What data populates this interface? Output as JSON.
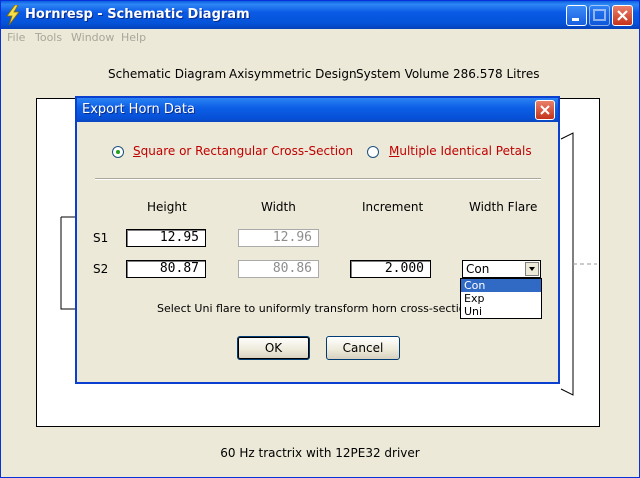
{
  "window": {
    "title": "Hornresp - Schematic Diagram"
  },
  "menu": [
    "File",
    "Tools",
    "Window",
    "Help"
  ],
  "header": {
    "label": "Schematic Diagram",
    "design": "Axisymmetric Design",
    "volume": "System Volume 286.578 Litres"
  },
  "footer": "60 Hz tractrix with 12PE32 driver",
  "dialog": {
    "title": "Export Horn Data",
    "radio_square": {
      "prefix": "S",
      "rest": "quare or Rectangular Cross-Section",
      "checked": true
    },
    "radio_petals": {
      "prefix": "M",
      "rest": "ultiple Identical Petals",
      "checked": false
    },
    "columns": [
      "Height",
      "Width",
      "Increment",
      "Width Flare"
    ],
    "rows": [
      {
        "label": "S1",
        "height": "12.95",
        "width": "12.96"
      },
      {
        "label": "S2",
        "height": "80.87",
        "width": "80.86",
        "increment": "2.000",
        "flare": "Con"
      }
    ],
    "hint": "Select Uni flare to uniformly transform horn cross-section aspect ra",
    "ok_label": "OK",
    "cancel_label": "Cancel",
    "flare_options": [
      "Con",
      "Exp",
      "Uni"
    ],
    "flare_selected": "Con"
  },
  "colors": {
    "titlebar": "#0453d8",
    "accent_red": "#c00000",
    "selection": "#316ac5"
  }
}
